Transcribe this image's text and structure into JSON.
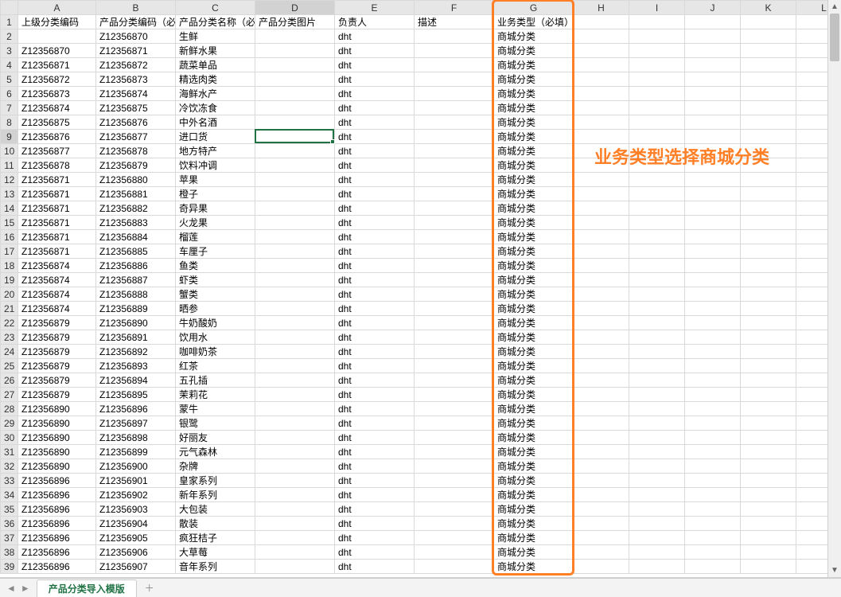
{
  "columns": [
    "A",
    "B",
    "C",
    "D",
    "E",
    "F",
    "G",
    "H",
    "I",
    "J",
    "K",
    "L"
  ],
  "headers": {
    "A": "上级分类编码",
    "B": "产品分类编码（必填",
    "C": "产品分类名称（必填",
    "D": "产品分类图片",
    "E": "负责人",
    "F": "描述",
    "G": "业务类型（必填）"
  },
  "active_cell": {
    "col": "D",
    "row": 9
  },
  "annotation": {
    "text": "业务类型选择商城分类"
  },
  "sheet_tab": {
    "name": "产品分类导入模版"
  },
  "rows": [
    {
      "r": 2,
      "A": "",
      "B": "Z12356870",
      "C": "生鲜",
      "E": "dht",
      "G": "商城分类"
    },
    {
      "r": 3,
      "A": "Z12356870",
      "B": "Z12356871",
      "C": "新鲜水果",
      "E": "dht",
      "G": "商城分类"
    },
    {
      "r": 4,
      "A": "Z12356871",
      "B": "Z12356872",
      "C": "蔬菜单品",
      "E": "dht",
      "G": "商城分类"
    },
    {
      "r": 5,
      "A": "Z12356872",
      "B": "Z12356873",
      "C": "精选肉类",
      "E": "dht",
      "G": "商城分类"
    },
    {
      "r": 6,
      "A": "Z12356873",
      "B": "Z12356874",
      "C": "海鲜水产",
      "E": "dht",
      "G": "商城分类"
    },
    {
      "r": 7,
      "A": "Z12356874",
      "B": "Z12356875",
      "C": "冷饮冻食",
      "E": "dht",
      "G": "商城分类"
    },
    {
      "r": 8,
      "A": "Z12356875",
      "B": "Z12356876",
      "C": "中外名酒",
      "E": "dht",
      "G": "商城分类"
    },
    {
      "r": 9,
      "A": "Z12356876",
      "B": "Z12356877",
      "C": "进口货",
      "E": "dht",
      "G": "商城分类"
    },
    {
      "r": 10,
      "A": "Z12356877",
      "B": "Z12356878",
      "C": "地方特产",
      "E": "dht",
      "G": "商城分类"
    },
    {
      "r": 11,
      "A": "Z12356878",
      "B": "Z12356879",
      "C": "饮料冲调",
      "E": "dht",
      "G": "商城分类"
    },
    {
      "r": 12,
      "A": "Z12356871",
      "B": "Z12356880",
      "C": "苹果",
      "E": "dht",
      "G": "商城分类"
    },
    {
      "r": 13,
      "A": "Z12356871",
      "B": "Z12356881",
      "C": "橙子",
      "E": "dht",
      "G": "商城分类"
    },
    {
      "r": 14,
      "A": "Z12356871",
      "B": "Z12356882",
      "C": "奇异果",
      "E": "dht",
      "G": "商城分类"
    },
    {
      "r": 15,
      "A": "Z12356871",
      "B": "Z12356883",
      "C": "火龙果",
      "E": "dht",
      "G": "商城分类"
    },
    {
      "r": 16,
      "A": "Z12356871",
      "B": "Z12356884",
      "C": "榴莲",
      "E": "dht",
      "G": "商城分类"
    },
    {
      "r": 17,
      "A": "Z12356871",
      "B": "Z12356885",
      "C": "车厘子",
      "E": "dht",
      "G": "商城分类"
    },
    {
      "r": 18,
      "A": "Z12356874",
      "B": "Z12356886",
      "C": "鱼类",
      "E": "dht",
      "G": "商城分类"
    },
    {
      "r": 19,
      "A": "Z12356874",
      "B": "Z12356887",
      "C": "虾类",
      "E": "dht",
      "G": "商城分类"
    },
    {
      "r": 20,
      "A": "Z12356874",
      "B": "Z12356888",
      "C": "蟹类",
      "E": "dht",
      "G": "商城分类"
    },
    {
      "r": 21,
      "A": "Z12356874",
      "B": "Z12356889",
      "C": "晒参",
      "E": "dht",
      "G": "商城分类"
    },
    {
      "r": 22,
      "A": "Z12356879",
      "B": "Z12356890",
      "C": "牛奶酸奶",
      "E": "dht",
      "G": "商城分类"
    },
    {
      "r": 23,
      "A": "Z12356879",
      "B": "Z12356891",
      "C": "饮用水",
      "E": "dht",
      "G": "商城分类"
    },
    {
      "r": 24,
      "A": "Z12356879",
      "B": "Z12356892",
      "C": "咖啡奶茶",
      "E": "dht",
      "G": "商城分类"
    },
    {
      "r": 25,
      "A": "Z12356879",
      "B": "Z12356893",
      "C": "红茶",
      "E": "dht",
      "G": "商城分类"
    },
    {
      "r": 26,
      "A": "Z12356879",
      "B": "Z12356894",
      "C": "五孔插",
      "E": "dht",
      "G": "商城分类"
    },
    {
      "r": 27,
      "A": "Z12356879",
      "B": "Z12356895",
      "C": "茉莉花",
      "E": "dht",
      "G": "商城分类"
    },
    {
      "r": 28,
      "A": "Z12356890",
      "B": "Z12356896",
      "C": "蒙牛",
      "E": "dht",
      "G": "商城分类"
    },
    {
      "r": 29,
      "A": "Z12356890",
      "B": "Z12356897",
      "C": "银鹭",
      "E": "dht",
      "G": "商城分类"
    },
    {
      "r": 30,
      "A": "Z12356890",
      "B": "Z12356898",
      "C": "好丽友",
      "E": "dht",
      "G": "商城分类"
    },
    {
      "r": 31,
      "A": "Z12356890",
      "B": "Z12356899",
      "C": "元气森林",
      "E": "dht",
      "G": "商城分类"
    },
    {
      "r": 32,
      "A": "Z12356890",
      "B": "Z12356900",
      "C": "杂牌",
      "E": "dht",
      "G": "商城分类"
    },
    {
      "r": 33,
      "A": "Z12356896",
      "B": "Z12356901",
      "C": "皇家系列",
      "E": "dht",
      "G": "商城分类"
    },
    {
      "r": 34,
      "A": "Z12356896",
      "B": "Z12356902",
      "C": "新年系列",
      "E": "dht",
      "G": "商城分类"
    },
    {
      "r": 35,
      "A": "Z12356896",
      "B": "Z12356903",
      "C": "大包装",
      "E": "dht",
      "G": "商城分类"
    },
    {
      "r": 36,
      "A": "Z12356896",
      "B": "Z12356904",
      "C": "散装",
      "E": "dht",
      "G": "商城分类"
    },
    {
      "r": 37,
      "A": "Z12356896",
      "B": "Z12356905",
      "C": "疯狂桔子",
      "E": "dht",
      "G": "商城分类"
    },
    {
      "r": 38,
      "A": "Z12356896",
      "B": "Z12356906",
      "C": "大草莓",
      "E": "dht",
      "G": "商城分类"
    },
    {
      "r": 39,
      "A": "Z12356896",
      "B": "Z12356907",
      "C": "音年系列",
      "E": "dht",
      "G": "商城分类"
    }
  ]
}
